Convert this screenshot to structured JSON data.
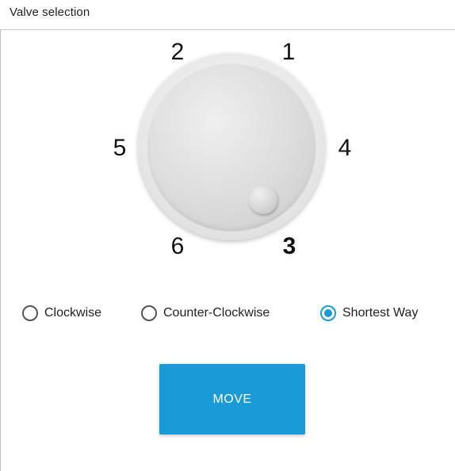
{
  "panel": {
    "title": "Valve selection"
  },
  "valve": {
    "positions": [
      "2",
      "1",
      "5",
      "4",
      "6",
      "3"
    ],
    "active_position": "3",
    "icons": {
      "knob": "rotary-knob-icon",
      "indicator": "knob-indicator-icon"
    }
  },
  "direction": {
    "options": [
      {
        "label": "Clockwise",
        "selected": false
      },
      {
        "label": "Counter-Clockwise",
        "selected": false
      },
      {
        "label": "Shortest Way",
        "selected": true
      }
    ],
    "selected_color": "#1a9bd8"
  },
  "actions": {
    "move_label": "MOVE",
    "button_color": "#1a9bd8"
  }
}
